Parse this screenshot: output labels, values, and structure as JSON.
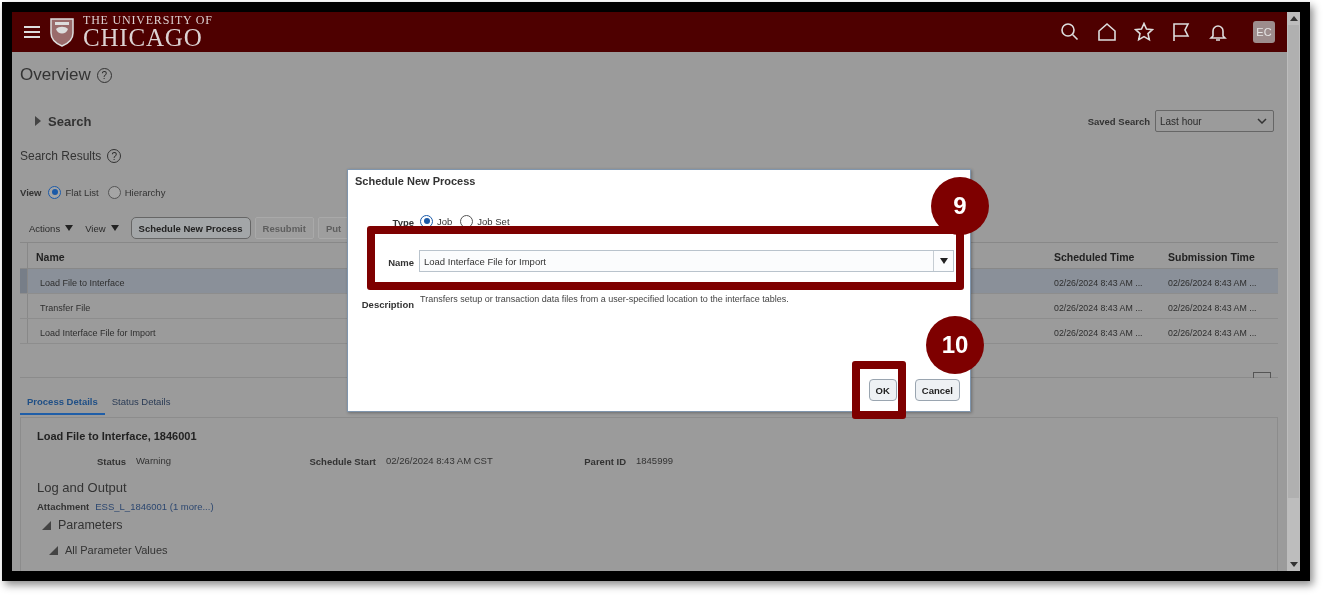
{
  "header": {
    "logo_line1": "THE UNIVERSITY OF",
    "logo_line2": "CHICAGO",
    "avatar": "EC"
  },
  "page": {
    "title": "Overview",
    "title_help": "?",
    "search": {
      "label": "Search",
      "expanded": false
    },
    "saved_search": {
      "label": "Saved Search",
      "value": "Last hour"
    },
    "results_title": "Search Results",
    "results_help": "?",
    "view": {
      "label": "View",
      "options": [
        {
          "label": "Flat List",
          "selected": true
        },
        {
          "label": "Hierarchy",
          "selected": false
        }
      ]
    },
    "toolbar": {
      "menus": [
        "Actions",
        "View"
      ],
      "buttons": [
        {
          "label": "Schedule New Process",
          "disabled": false
        },
        {
          "label": "Resubmit",
          "disabled": true
        },
        {
          "label": "Put",
          "disabled": true
        }
      ]
    },
    "table": {
      "columns": [
        {
          "label": "Name"
        },
        {
          "label": "Scheduled Time"
        },
        {
          "label": "Submission Time"
        }
      ],
      "rows": [
        {
          "cells": [
            "Load File to Interface",
            "02/26/2024 8:43 AM ...",
            "02/26/2024 8:43 AM ..."
          ],
          "selected": true
        },
        {
          "cells": [
            "Transfer File",
            "02/26/2024 8:43 AM ...",
            "02/26/2024 8:43 AM ..."
          ],
          "selected": false
        },
        {
          "cells": [
            "Load Interface File for Import",
            "02/26/2024 8:43 AM ...",
            "02/26/2024 8:43 AM ..."
          ],
          "selected": false
        }
      ]
    },
    "detail_tabs": [
      {
        "label": "Process Details",
        "selected": true
      },
      {
        "label": "Status Details",
        "selected": false
      }
    ],
    "detail": {
      "title": "Load File to Interface, 1846001",
      "fields": [
        {
          "label": "Status",
          "value": "Warning"
        },
        {
          "label": "Schedule Start",
          "value": "02/26/2024 8:43 AM CST"
        },
        {
          "label": "Parent ID",
          "value": "1845999"
        }
      ],
      "log_title": "Log and Output",
      "attachment": {
        "label": "Attachment",
        "link": "ESS_L_1846001 (1 more...)"
      },
      "sections": [
        {
          "label": "Parameters",
          "expanded": true,
          "children": [
            {
              "label": "All Parameter Values",
              "expanded": true
            }
          ]
        }
      ]
    }
  },
  "dialog": {
    "title": "Schedule New Process",
    "type": {
      "label": "Type",
      "options": [
        {
          "label": "Job",
          "selected": true
        },
        {
          "label": "Job Set",
          "selected": false
        }
      ]
    },
    "name": {
      "label": "Name",
      "value": "Load Interface File for Import"
    },
    "description": {
      "label": "Description",
      "text": "Transfers setup or transaction data files from a user-specified location to the interface tables."
    },
    "buttons": [
      "OK",
      "Cancel"
    ]
  },
  "callouts": [
    {
      "number": "9"
    },
    {
      "number": "10"
    }
  ]
}
